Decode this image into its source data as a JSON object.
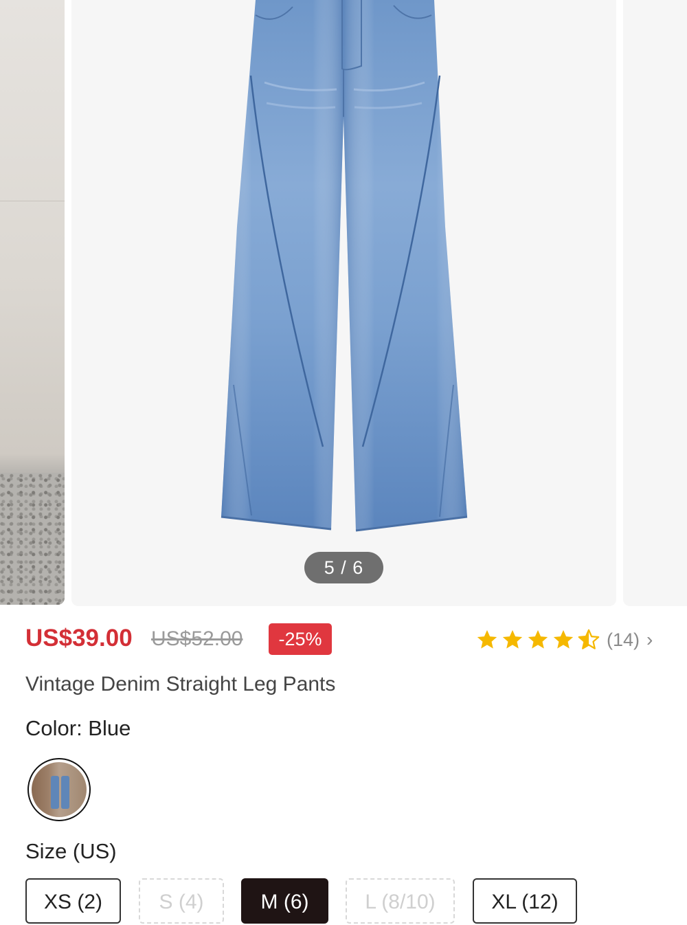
{
  "gallery": {
    "counter": "5 / 6"
  },
  "product": {
    "price": "US$39.00",
    "original_price": "US$52.00",
    "discount": "-25%",
    "rating": 4.5,
    "review_count": "(14)",
    "title": "Vintage Denim Straight Leg Pants",
    "color_label": "Color: Blue",
    "size_label": "Size (US)",
    "sizes": [
      {
        "label": "XS (2)",
        "state": "available"
      },
      {
        "label": "S (4)",
        "state": "sold-out"
      },
      {
        "label": "M (6)",
        "state": "selected"
      },
      {
        "label": "L (8/10)",
        "state": "sold-out"
      },
      {
        "label": "XL (12)",
        "state": "available"
      }
    ]
  },
  "icons": {
    "star": "star-icon",
    "chevron": "chevron-right-icon"
  },
  "colors": {
    "price_red": "#d32f36",
    "discount_bg": "#e0373f",
    "star_gold": "#f5b800",
    "selected_size_bg": "#1f1414"
  }
}
